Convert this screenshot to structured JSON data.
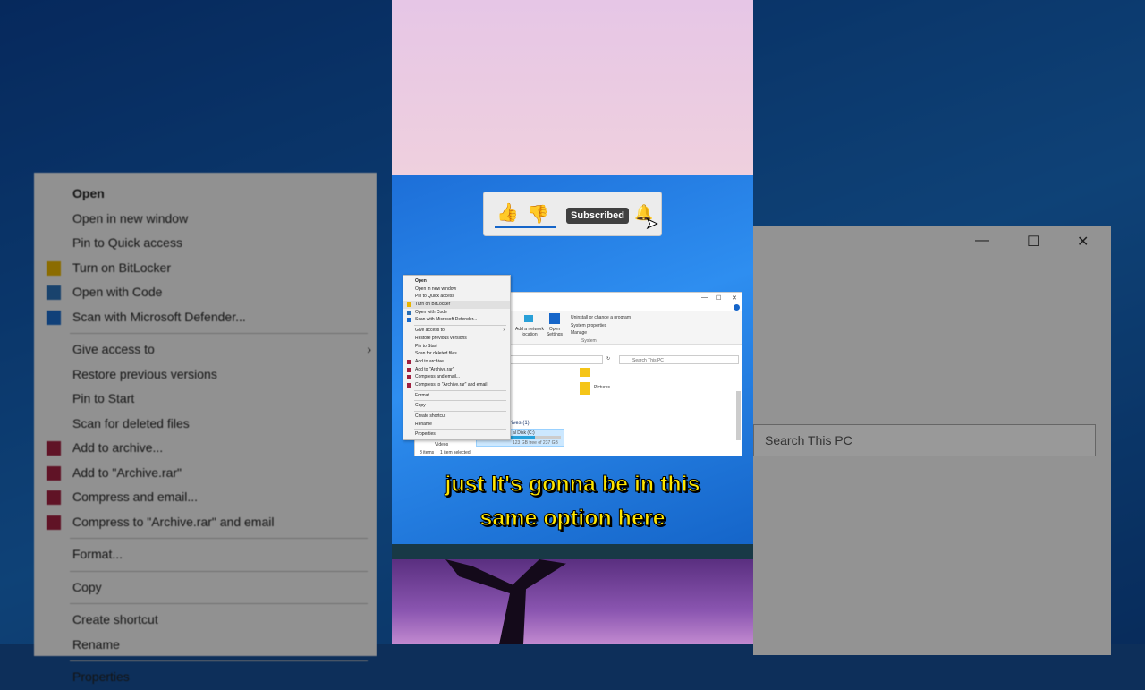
{
  "context_menu": {
    "items": [
      {
        "label": "Open",
        "bold": true
      },
      {
        "label": "Open in new window"
      },
      {
        "label": "Pin to Quick access"
      },
      {
        "label": "Turn on BitLocker",
        "icon": "shield-icon",
        "hover": true
      },
      {
        "label": "Open with Code",
        "icon": "vscode-icon"
      },
      {
        "label": "Scan with Microsoft Defender...",
        "icon": "defender-icon"
      },
      {
        "sep": true
      },
      {
        "label": "Give access to",
        "submenu": true
      },
      {
        "label": "Restore previous versions"
      },
      {
        "label": "Pin to Start"
      },
      {
        "label": "Scan for deleted files"
      },
      {
        "label": "Add to archive...",
        "icon": "winrar-icon"
      },
      {
        "label": "Add to \"Archive.rar\"",
        "icon": "winrar-icon"
      },
      {
        "label": "Compress and email...",
        "icon": "winrar-icon"
      },
      {
        "label": "Compress to \"Archive.rar\" and email",
        "icon": "winrar-icon"
      },
      {
        "sep": true
      },
      {
        "label": "Format..."
      },
      {
        "sep": true
      },
      {
        "label": "Copy"
      },
      {
        "sep": true
      },
      {
        "label": "Create shortcut"
      },
      {
        "label": "Rename"
      },
      {
        "sep": true
      },
      {
        "label": "Properties"
      }
    ]
  },
  "subscribe_bar": {
    "subscribed_label": "Subscribed"
  },
  "explorer": {
    "add_network_location": "Add a network location",
    "open_settings": "Open Settings",
    "uninstall": "Uninstall or change a program",
    "system_properties": "System properties",
    "manage": "Manage",
    "system_group": "System",
    "search_placeholder": "Search This PC",
    "pictures": "Pictures",
    "drives_header": "rives (1)",
    "disk_label": "al Disk (C:)",
    "disk_free": "123 GB free of 237 GB",
    "disk_used_fraction": 0.48,
    "videos": "Videos",
    "item_count": "8 items",
    "selection": "1 item selected"
  },
  "caption": {
    "line1": "just It's gonna be in this",
    "line2": "same option here"
  },
  "colors": {
    "accent": "#1565c9",
    "caption": "#ffe600"
  }
}
